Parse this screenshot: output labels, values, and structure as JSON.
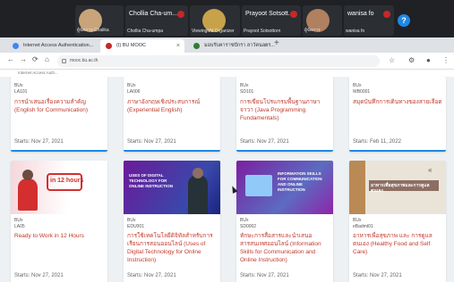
{
  "call": {
    "participants": [
      {
        "name": "",
        "sub": "ผู้จัดการ Chalika",
        "color": "#c9a37a"
      },
      {
        "name": "Chollia Cha-um...",
        "sub": "Chollia Cha-umpa",
        "color": "#3d3d3d"
      },
      {
        "name": "",
        "sub": "ViewingMtt Organizer",
        "color": "#c7a24a"
      },
      {
        "name": "Prayoot Sotsott...",
        "sub": "Prayoot Sotsottorn",
        "color": "#3d3d3d"
      },
      {
        "name": "",
        "sub": "ผู้จัดการ",
        "color": "#b08060"
      },
      {
        "name": "wanisa fo",
        "sub": "wanisa fo",
        "color": "#3d3d3d"
      }
    ],
    "help_label": "?"
  },
  "tabs": [
    {
      "label": "Internet Access Authentication...",
      "favicon_color": "#4285f4"
    },
    {
      "label": "(I) BU MOOC",
      "favicon_color": "#c62828"
    },
    {
      "label": "มอบรับคาราชปักรา ลาวัคนอกร...",
      "favicon_color": "#2e7d32"
    }
  ],
  "newtab_label": "+",
  "address": {
    "url": "mooc.bu.ac.th",
    "back": "←",
    "forward": "→",
    "reload": "⟳",
    "home": "⌂",
    "star": "☆",
    "extensions": "⚙",
    "profile": "●",
    "menu": "⋮"
  },
  "bookmarks": "Internet Access Auth...",
  "courses_row1": [
    {
      "org": "BUx",
      "code": "LA101",
      "title": "การนำเสนอเรื่องความสำคัญ (English for Communication)",
      "starts": "Starts: Nov 27, 2021"
    },
    {
      "org": "BUx",
      "code": "LA006",
      "title": "ภาษาอังกฤษเชิงประสบการณ์ (Experiential English)",
      "starts": "Starts: Nov 27, 2021"
    },
    {
      "org": "BUx",
      "code": "SD101",
      "title": "การเขียนโปรแกรมพื้นฐานภาษาจาวา (Java Programming Fundamentals)",
      "starts": "Starts: Nov 27, 2021"
    },
    {
      "org": "BUx",
      "code": "WB0001",
      "title": "สมุดบันทึกการเดินทางของสายเลือด",
      "starts": "Starts: Feb 11, 2022"
    }
  ],
  "courses_row2": [
    {
      "org": "BUx",
      "code": "LA05",
      "title": "Ready to Work in 12 Hours",
      "starts": "Starts: Nov 27, 2021",
      "thumb_text": "in 12 hours"
    },
    {
      "org": "BUx",
      "code": "EDU001",
      "title": "การใช้เทคโนโลยีดิจิทัลสำหรับการเรียนการสอนออนไลน์ (Uses of Digital Technology for Online Instruction)",
      "starts": "Starts: Nov 27, 2021",
      "thumb_text": "USES OF DIGITAL TECHNOLOGY FOR ONLINE INSTRUCTION"
    },
    {
      "org": "BUx",
      "code": "SD0002",
      "title": "ทักษะการสื่อสารและนำเสนอ สารสนเทศออนไลน์ (Information Skills for Communication and Online Instruction)",
      "starts": "Starts: Nov 27, 2021",
      "thumb_text": "INFORMATION SKILLS FOR COMMUNICATION AND ONLINE INSTRUCTION"
    },
    {
      "org": "BUx",
      "code": "eBadmt01",
      "title": "อาหารเพื่อสุขภาพ และ การดูแลตนเอง (Healthy Food and Self Care)",
      "starts": "Starts: Nov 27, 2021",
      "thumb_text": "อาหารเพื่อสุขภาพและการดูแลตนเอง"
    }
  ]
}
